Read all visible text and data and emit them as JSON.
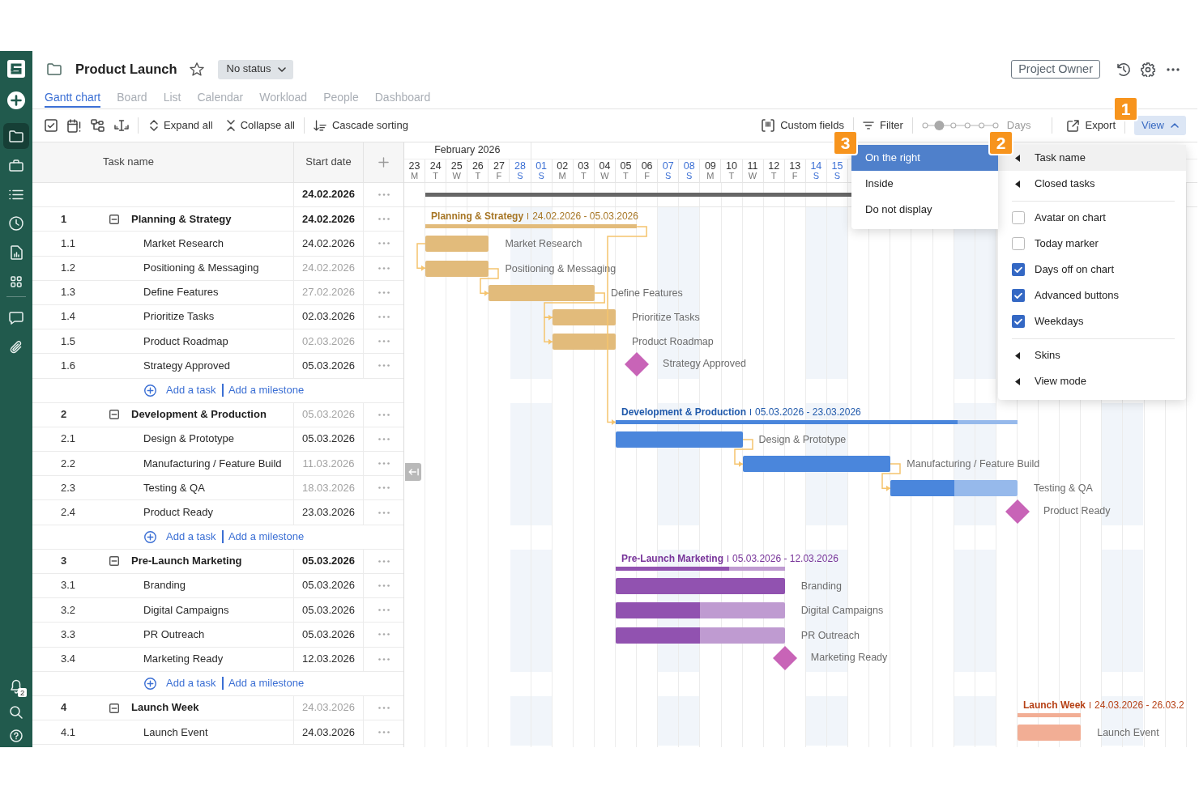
{
  "sidebar": {
    "nav": [
      {
        "selected": true
      },
      {
        "selected": false
      },
      {
        "selected": false
      },
      {
        "selected": false
      },
      {
        "selected": false
      },
      {
        "selected": false
      },
      {
        "selected": false
      },
      {
        "selected": false
      }
    ],
    "notifications_badge": "2"
  },
  "header": {
    "title": "Product Launch",
    "starred": false,
    "status": "No status",
    "owner": "Project Owner"
  },
  "tabs": [
    {
      "label": "Gantt chart",
      "selected": true
    },
    {
      "label": "Board",
      "selected": false
    },
    {
      "label": "List",
      "selected": false
    },
    {
      "label": "Calendar",
      "selected": false
    },
    {
      "label": "Workload",
      "selected": false
    },
    {
      "label": "People",
      "selected": false
    },
    {
      "label": "Dashboard",
      "selected": false
    }
  ],
  "toolbar": {
    "expand_all": "Expand all",
    "collapse_all": "Collapse all",
    "cascade_sorting": "Cascade sorting",
    "custom_fields": "Custom fields",
    "filter": "Filter",
    "zoom": {
      "level": 0.2,
      "unit": "Days"
    },
    "export": "Export",
    "view": {
      "label": "View",
      "expanded": true,
      "callout": "1",
      "menu": {
        "callout": "2",
        "items": [
          {
            "kind": "submenu",
            "label": "Task name",
            "open": true
          },
          {
            "kind": "submenu",
            "label": "Closed tasks",
            "open": false
          },
          {
            "kind": "divider"
          },
          {
            "kind": "checkbox",
            "label": "Avatar on chart",
            "checked": false
          },
          {
            "kind": "checkbox",
            "label": "Today marker",
            "checked": false
          },
          {
            "kind": "checkbox",
            "label": "Days off on chart",
            "checked": true
          },
          {
            "kind": "checkbox",
            "label": "Advanced buttons",
            "checked": true
          },
          {
            "kind": "checkbox",
            "label": "Weekdays",
            "checked": true
          },
          {
            "kind": "divider"
          },
          {
            "kind": "submenu",
            "label": "Skins",
            "open": false
          },
          {
            "kind": "submenu",
            "label": "View mode",
            "open": false
          }
        ],
        "submenu": {
          "callout": "3",
          "options": [
            {
              "label": "On the right",
              "selected": true
            },
            {
              "label": "Inside",
              "selected": false
            },
            {
              "label": "Do not display",
              "selected": false
            }
          ]
        }
      }
    }
  },
  "grid": {
    "columns": [
      "Task name",
      "Start date"
    ],
    "project_row": {
      "start_date": "24.02.2026"
    },
    "groups": [
      {
        "wbs": "1",
        "name": "Planning & Strategy",
        "expanded": true,
        "start_date": "24.02.2026",
        "date_dimmed": false,
        "bar_label": "Planning & Strategy",
        "bar_range": "24.02.2026 - 05.03.2026",
        "color": "#e2bb7b",
        "level": 1,
        "linked": false,
        "children": [
          {
            "kind": "task",
            "wbs": "1.1",
            "name": "Market Research",
            "start_date": "24.02.2026",
            "date_dimmed": false,
            "level": 1,
            "bar_label": "Market Research",
            "linked": false
          },
          {
            "kind": "task",
            "wbs": "1.2",
            "name": "Positioning & Messaging",
            "start_date": "24.02.2026",
            "date_dimmed": true,
            "level": 1,
            "bar_label": "Positioning & Messaging",
            "linked": true
          },
          {
            "kind": "task",
            "wbs": "1.3",
            "name": "Define Features",
            "start_date": "27.02.2026",
            "date_dimmed": true,
            "level": 1,
            "bar_label": "Define Features",
            "linked": true
          },
          {
            "kind": "task",
            "wbs": "1.4",
            "name": "Prioritize Tasks",
            "start_date": "02.03.2026",
            "date_dimmed": false,
            "level": 1,
            "bar_label": "Prioritize Tasks",
            "linked": true
          },
          {
            "kind": "task",
            "wbs": "1.5",
            "name": "Product Roadmap",
            "start_date": "02.03.2026",
            "date_dimmed": true,
            "level": 1,
            "bar_label": "Product Roadmap",
            "linked": true
          },
          {
            "kind": "milestone",
            "wbs": "1.6",
            "name": "Strategy Approved",
            "start_date": "05.03.2026",
            "date_dimmed": false,
            "bar_label": "Strategy Approved",
            "linked": false
          }
        ],
        "add_links": {
          "task": "Add a task",
          "milestone": "Add a milestone"
        }
      },
      {
        "wbs": "2",
        "name": "Development & Production",
        "expanded": true,
        "start_date": "05.03.2026",
        "date_dimmed": true,
        "bar_label": "Development & Production",
        "bar_range": "05.03.2026 - 23.03.2026",
        "color": "#4a86dc",
        "level": 0.85,
        "linked": true,
        "children": [
          {
            "kind": "task",
            "wbs": "2.1",
            "name": "Design & Prototype",
            "start_date": "05.03.2026",
            "date_dimmed": false,
            "level": 1,
            "bar_label": "Design & Prototype",
            "linked": false
          },
          {
            "kind": "task",
            "wbs": "2.2",
            "name": "Manufacturing / Feature Build",
            "start_date": "11.03.2026",
            "date_dimmed": true,
            "level": 1,
            "bar_label": "Manufacturing / Feature Build",
            "linked": true
          },
          {
            "kind": "task",
            "wbs": "2.3",
            "name": "Testing & QA",
            "start_date": "18.03.2026",
            "date_dimmed": true,
            "level": 0.5,
            "bar_label": "Testing & QA",
            "linked": true
          },
          {
            "kind": "milestone",
            "wbs": "2.4",
            "name": "Product Ready",
            "start_date": "23.03.2026",
            "date_dimmed": false,
            "bar_label": "Product Ready",
            "linked": false
          }
        ],
        "add_links": {
          "task": "Add a task",
          "milestone": "Add a milestone"
        }
      },
      {
        "wbs": "3",
        "name": "Pre-Launch Marketing",
        "expanded": true,
        "start_date": "05.03.2026",
        "date_dimmed": false,
        "bar_label": "Pre-Launch Marketing",
        "bar_range": "05.03.2026 - 12.03.2026",
        "color": "#9152b0",
        "level": 0.67,
        "linked": false,
        "children": [
          {
            "kind": "task",
            "wbs": "3.1",
            "name": "Branding",
            "start_date": "05.03.2026",
            "date_dimmed": false,
            "level": 1,
            "bar_label": "Branding",
            "linked": false
          },
          {
            "kind": "task",
            "wbs": "3.2",
            "name": "Digital Campaigns",
            "start_date": "05.03.2026",
            "date_dimmed": false,
            "level": 0.5,
            "bar_label": "Digital Campaigns",
            "linked": false
          },
          {
            "kind": "task",
            "wbs": "3.3",
            "name": "PR Outreach",
            "start_date": "05.03.2026",
            "date_dimmed": false,
            "level": 0.5,
            "bar_label": "PR Outreach",
            "linked": false
          },
          {
            "kind": "milestone",
            "wbs": "3.4",
            "name": "Marketing Ready",
            "start_date": "12.03.2026",
            "date_dimmed": false,
            "bar_label": "Marketing Ready",
            "linked": false
          }
        ],
        "add_links": {
          "task": "Add a task",
          "milestone": "Add a milestone"
        }
      },
      {
        "wbs": "4",
        "name": "Launch Week",
        "expanded": true,
        "start_date": "24.03.2026",
        "date_dimmed": true,
        "bar_label": "Launch Week",
        "bar_range": "24.03.2026 - 26.03.2",
        "color": "#f2ae95",
        "level": 1,
        "linked": false,
        "children": [
          {
            "kind": "task",
            "wbs": "4.1",
            "name": "Launch Event",
            "start_date": "24.03.2026",
            "date_dimmed": false,
            "level": 1,
            "bar_label": "Launch Event",
            "linked": false
          }
        ]
      }
    ]
  },
  "timeline": {
    "month": "February 2026",
    "days": [
      {
        "day": "23",
        "weekday": "M",
        "weekend": false
      },
      {
        "day": "24",
        "weekday": "T",
        "weekend": false
      },
      {
        "day": "25",
        "weekday": "W",
        "weekend": false
      },
      {
        "day": "26",
        "weekday": "T",
        "weekend": false
      },
      {
        "day": "27",
        "weekday": "F",
        "weekend": false
      },
      {
        "day": "28",
        "weekday": "S",
        "weekend": true
      },
      {
        "day": "01",
        "weekday": "S",
        "weekend": true
      },
      {
        "day": "02",
        "weekday": "M",
        "weekend": false
      },
      {
        "day": "03",
        "weekday": "T",
        "weekend": false
      },
      {
        "day": "04",
        "weekday": "W",
        "weekend": false
      },
      {
        "day": "05",
        "weekday": "T",
        "weekend": false
      },
      {
        "day": "06",
        "weekday": "F",
        "weekend": false
      },
      {
        "day": "07",
        "weekday": "S",
        "weekend": true
      },
      {
        "day": "08",
        "weekday": "S",
        "weekend": true
      },
      {
        "day": "09",
        "weekday": "M",
        "weekend": false
      },
      {
        "day": "10",
        "weekday": "T",
        "weekend": false
      },
      {
        "day": "11",
        "weekday": "W",
        "weekend": false
      },
      {
        "day": "12",
        "weekday": "T",
        "weekend": false
      },
      {
        "day": "13",
        "weekday": "F",
        "weekend": false
      },
      {
        "day": "14",
        "weekday": "S",
        "weekend": true
      },
      {
        "day": "15",
        "weekday": "S",
        "weekend": true
      }
    ]
  }
}
